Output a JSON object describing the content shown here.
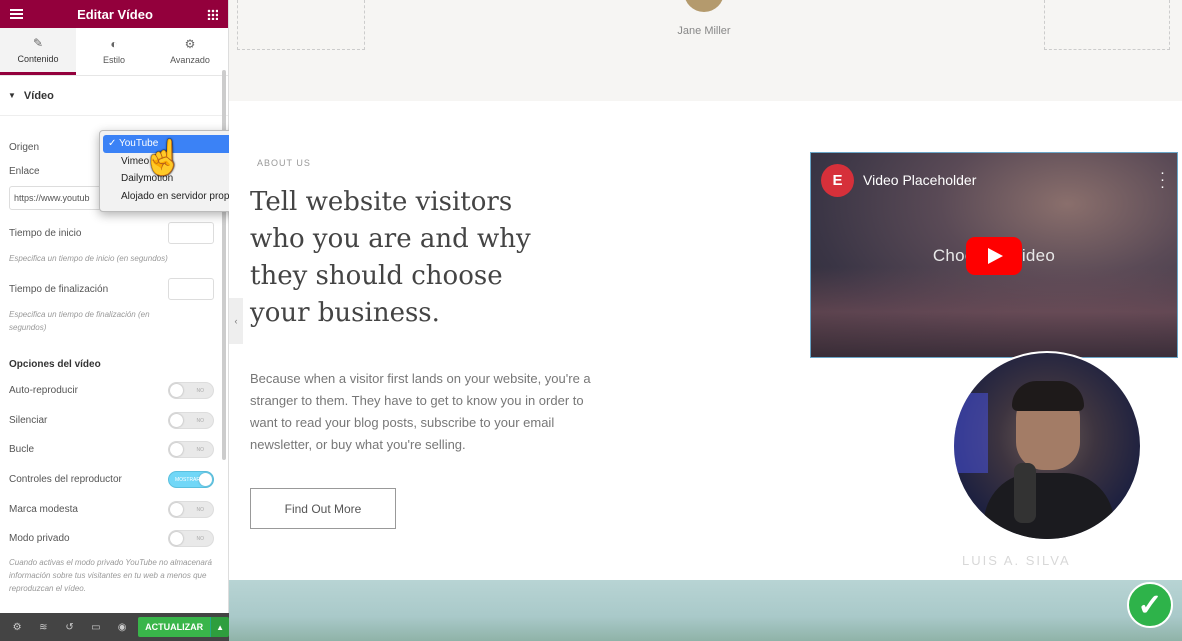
{
  "panel": {
    "title": "Editar Vídeo",
    "tabs": [
      {
        "label": "Contenido",
        "icon": "pencil-icon"
      },
      {
        "label": "Estilo",
        "icon": "contrast-icon"
      },
      {
        "label": "Avanzado",
        "icon": "gear-icon"
      }
    ],
    "section_title": "Vídeo",
    "origin_label": "Origen",
    "link_label": "Enlace",
    "link_value": "https://www.youtub",
    "start_label": "Tiempo de inicio",
    "start_hint": "Especifica un tiempo de inicio (en segundos)",
    "end_label": "Tiempo de finalización",
    "end_hint": "Especifica un tiempo de finalización (en segundos)",
    "options_title": "Opciones del vídeo",
    "toggles": [
      {
        "label": "Auto-reproducir",
        "state": "NO"
      },
      {
        "label": "Silenciar",
        "state": "NO"
      },
      {
        "label": "Bucle",
        "state": "NO"
      },
      {
        "label": "Controles del reproductor",
        "state": "MOSTRAR"
      },
      {
        "label": "Marca modesta",
        "state": "NO"
      },
      {
        "label": "Modo privado",
        "state": "NO"
      }
    ],
    "private_hint": "Cuando activas el modo privado YouTube no almacenará información sobre tus visitantes en tu web a menos que reproduzcan el vídeo.",
    "update_label": "ACTUALIZAR"
  },
  "dropdown": {
    "options": [
      "YouTube",
      "Vimeo",
      "Dailymotion",
      "Alojado en servidor propio"
    ],
    "selected": "YouTube"
  },
  "canvas": {
    "testimonial_name": "Jane Miller",
    "eyebrow": "ABOUT US",
    "headline": "Tell website visitors who you are and why they should choose your business.",
    "body": "Because when a visitor first lands on your website, you're a stranger to them. They have to get to know you in order to want to read your blog posts, subscribe to your email newsletter, or buy what you're selling.",
    "cta_label": "Find Out More",
    "video_title": "Video Placeholder",
    "video_center": "Choose a video",
    "watermark": "LUIS A. SILVA"
  },
  "colors": {
    "brand": "#93003c",
    "update": "#39b54a",
    "toggle_on": "#71d7f7",
    "youtube": "#ff0000"
  }
}
